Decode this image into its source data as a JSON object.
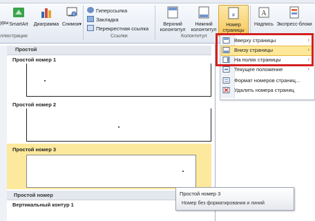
{
  "ribbon": {
    "left_partial_label": "уры",
    "insert_group": {
      "smartart": "SmartArt",
      "chart": "Диаграмма",
      "screenshot": "Снимок",
      "group_label": "ллюстрации"
    },
    "links_group": {
      "hyperlink": "Гиперссылка",
      "bookmark": "Закладка",
      "crossref": "Перекрестная ссылка",
      "group_label": "Ссылки"
    },
    "header_footer_group": {
      "header": "Верхний колонтитул",
      "footer": "Нижний колонтитул",
      "page_number": "Номер страницы",
      "group_label": "Колонтитул"
    },
    "text_group": {
      "textbox": "Надпись",
      "quickparts": "Экспресс-блоки"
    },
    "dropdown_arrow": "▾"
  },
  "gallery": {
    "header": "Простой",
    "items": [
      {
        "title": "Простой номер 1"
      },
      {
        "title": "Простой номер 2"
      },
      {
        "title": "Простой номер 3"
      }
    ],
    "section2_header": "Простой номер",
    "section2_item": "Вертикальный контур 1"
  },
  "menu": {
    "items": [
      {
        "label": "Вверху страницы",
        "arrow": "›",
        "icon": "page-top-icon"
      },
      {
        "label": "Внизу страницы",
        "arrow": "›",
        "icon": "page-bottom-icon"
      },
      {
        "label": "На полях страницы",
        "arrow": "›",
        "icon": "page-margin-icon"
      },
      {
        "label": "Текущее положение",
        "arrow": "›",
        "icon": "current-position-icon"
      },
      {
        "label": "Формат номеров страниц...",
        "arrow": "",
        "icon": "format-icon"
      },
      {
        "label": "Удалить номера страниц",
        "arrow": "",
        "icon": "delete-icon"
      }
    ],
    "highlighted_index": 1,
    "highlight_color": "#fde89a",
    "annotation_color": "#d21f1f"
  },
  "tooltip": {
    "title": "Простой номер 3",
    "description": "Номер без форматирования и линий"
  }
}
